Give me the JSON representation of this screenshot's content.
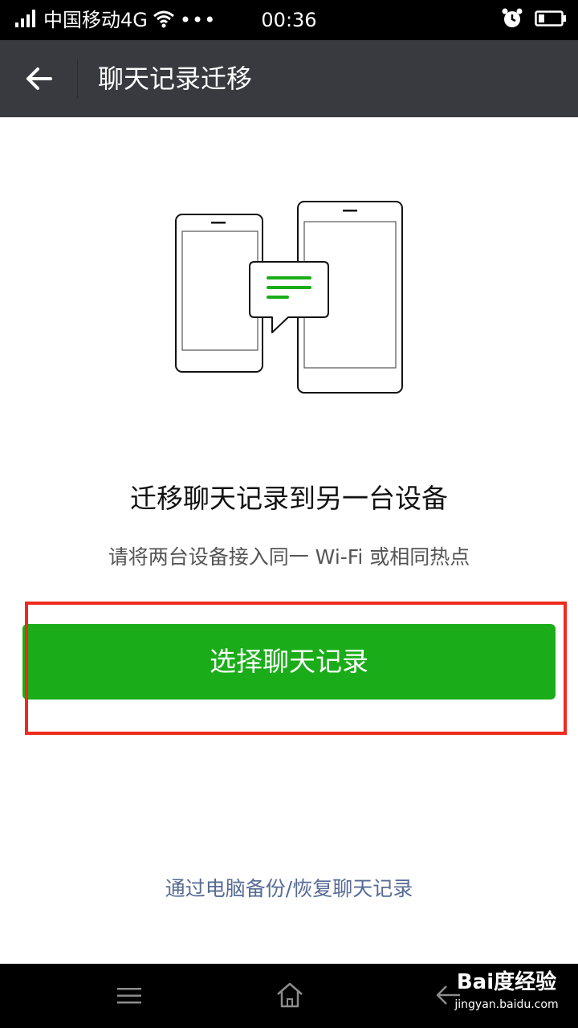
{
  "status_bar": {
    "carrier": "中国移动4G",
    "dots": "•••",
    "time": "00:36"
  },
  "header": {
    "title": "聊天记录迁移"
  },
  "main": {
    "heading": "迁移聊天记录到另一台设备",
    "subtext": "请将两台设备接入同一 Wi-Fi 或相同热点",
    "select_button": "选择聊天记录",
    "pc_link": "通过电脑备份/恢复聊天记录"
  },
  "watermark": {
    "logo": "Bai度经验",
    "url": "jingyan.baidu.com"
  },
  "colors": {
    "title_bar": "#393a3f",
    "accent_green": "#1aad19",
    "highlight_red": "#ee2b1d",
    "link_blue": "#576b95"
  },
  "icons": [
    "signal-icon",
    "wifi-icon",
    "alarm-icon",
    "battery-icon",
    "back-arrow-icon",
    "menu-icon",
    "home-icon",
    "nav-back-icon"
  ]
}
